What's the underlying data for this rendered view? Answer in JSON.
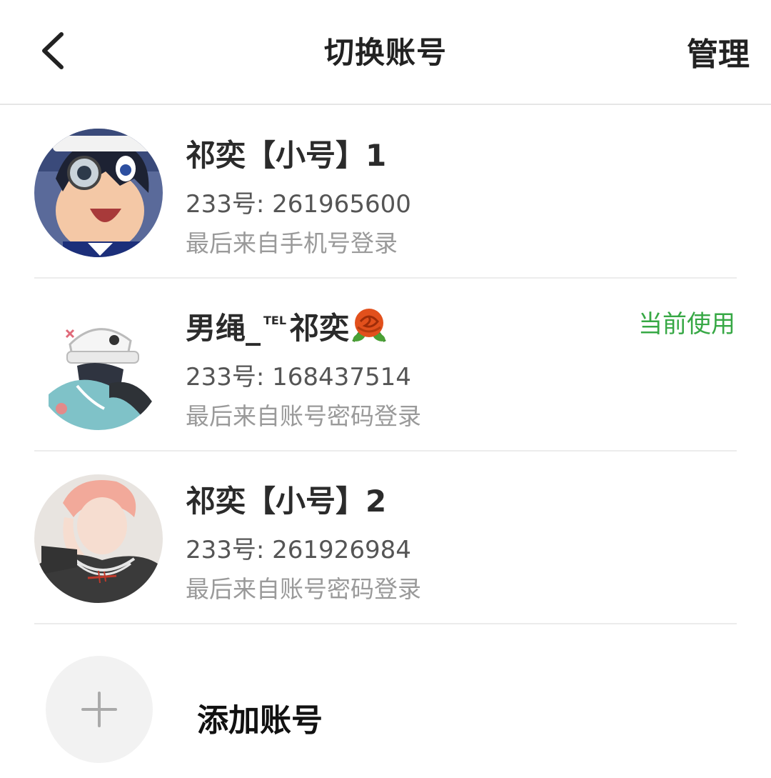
{
  "header": {
    "title": "切换账号",
    "manage_label": "管理"
  },
  "accounts": [
    {
      "name": "祁奕【小号】1",
      "id_line": "233号: 261965600",
      "login_line": "最后来自手机号登录",
      "current": false
    },
    {
      "name_main": "男绳_",
      "name_sup": "TEL",
      "name_tail": "祁奕",
      "id_line": "233号: 168437514",
      "login_line": "最后来自账号密码登录",
      "current": true,
      "current_label": "当前使用"
    },
    {
      "name": "祁奕【小号】2",
      "id_line": "233号: 261926984",
      "login_line": "最后来自账号密码登录",
      "current": false
    }
  ],
  "add_account": {
    "label": "添加账号",
    "icon": "plus-icon"
  },
  "icons": {
    "back": "chevron-left-icon",
    "rose": "rose-emoji-icon"
  },
  "colors": {
    "current_tag": "#37a845",
    "secondary_text": "#9a9a9a",
    "divider": "#ececec"
  }
}
